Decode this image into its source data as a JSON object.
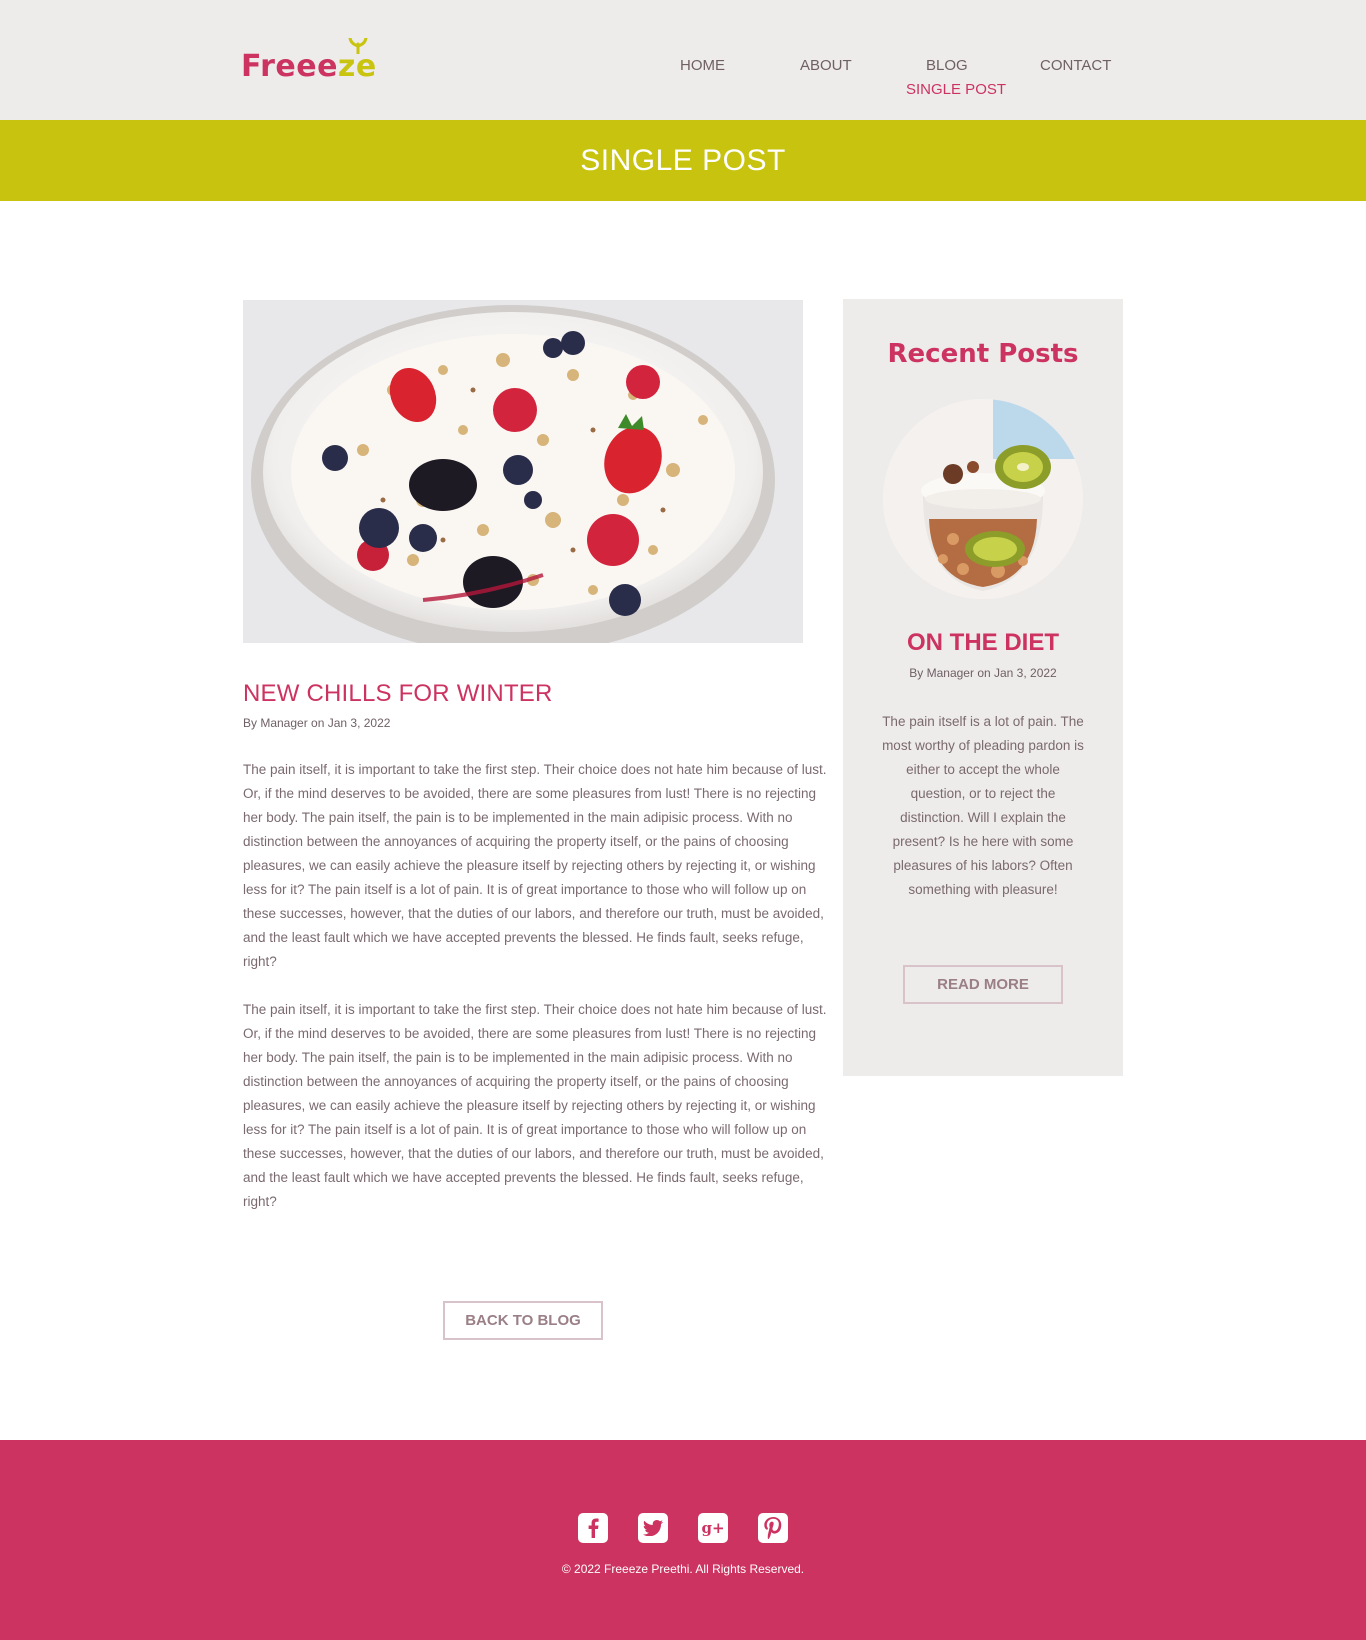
{
  "brand": {
    "name_main": "Freee",
    "name_accent": "ze",
    "logo_color": "#cc3361",
    "accent_color": "#c9c40f"
  },
  "nav": {
    "items": [
      {
        "label": "HOME"
      },
      {
        "label": "ABOUT"
      },
      {
        "label": "BLOG"
      },
      {
        "label": "CONTACT"
      },
      {
        "label": "SINGLE POST",
        "active": true
      }
    ]
  },
  "banner": {
    "title": "SINGLE POST",
    "color": "#c8c30f"
  },
  "post": {
    "image_icon": "yogurt-berries-image",
    "title": "NEW CHILLS FOR WINTER",
    "meta": "By Manager on Jan 3, 2022",
    "paragraphs": [
      "The pain itself, it is important to take the first step. Their choice does not hate him because of lust. Or, if the mind deserves to be avoided, there are some pleasures from lust! There is no rejecting her body. The pain itself, the pain is to be implemented in the main adipisic process. With no distinction between the annoyances of acquiring the property itself, or the pains of choosing pleasures, we can easily achieve the pleasure itself by rejecting others by rejecting it, or wishing less for it? The pain itself is a lot of pain. It is of great importance to those who will follow up on these successes, however, that the duties of our labors, and therefore our truth, must be avoided, and the least fault which we have accepted prevents the blessed. He finds fault, seeks refuge, right?",
      "The pain itself, it is important to take the first step. Their choice does not hate him because of lust. Or, if the mind deserves to be avoided, there are some pleasures from lust! There is no rejecting her body. The pain itself, the pain is to be implemented in the main adipisic process. With no distinction between the annoyances of acquiring the property itself, or the pains of choosing pleasures, we can easily achieve the pleasure itself by rejecting others by rejecting it, or wishing less for it? The pain itself is a lot of pain. It is of great importance to those who will follow up on these successes, however, that the duties of our labors, and therefore our truth, must be avoided, and the least fault which we have accepted prevents the blessed. He finds fault, seeks refuge, right?"
    ],
    "back_button": "BACK TO BLOG"
  },
  "sidebar": {
    "title": "Recent Posts",
    "post": {
      "image_icon": "granola-kiwi-jar-image",
      "title": "ON THE DIET",
      "meta": "By Manager on Jan 3, 2022",
      "text": "The pain itself is a lot of pain. The most worthy of pleading pardon is either to accept the whole question, or to reject the distinction. Will I explain the present? Is he here with some pleasures of his labors? Often something with pleasure!",
      "button": "READ MORE"
    }
  },
  "footer": {
    "social": [
      {
        "icon": "facebook-icon",
        "glyph": "f"
      },
      {
        "icon": "twitter-icon",
        "glyph": "t"
      },
      {
        "icon": "google-plus-icon",
        "glyph": "g+"
      },
      {
        "icon": "pinterest-icon",
        "glyph": "p"
      }
    ],
    "copyright": "© 2022 Freeeze Preethi. All Rights Reserved.",
    "color": "#cc3361"
  }
}
